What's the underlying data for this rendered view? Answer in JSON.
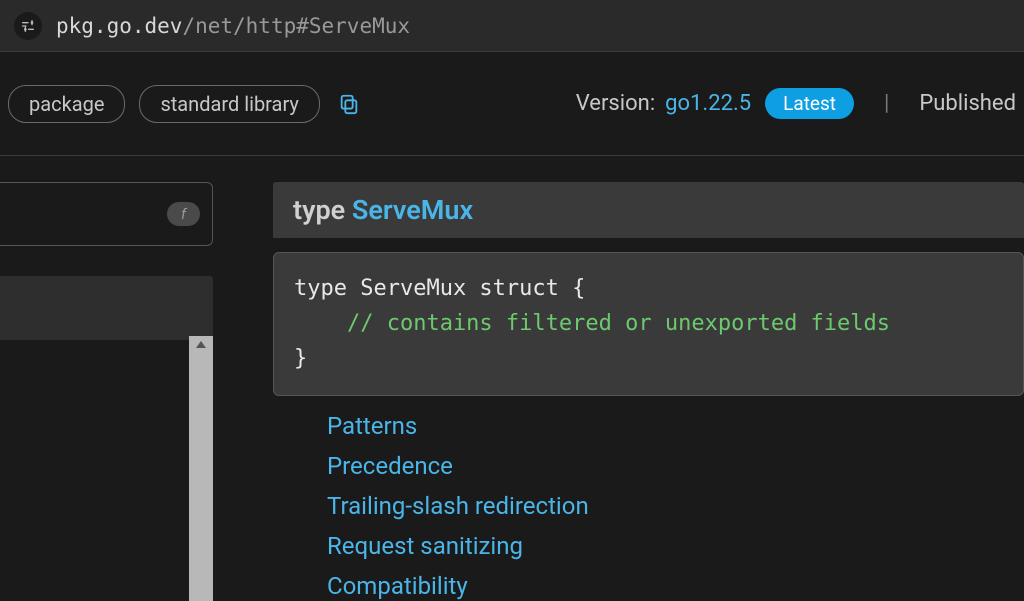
{
  "address": {
    "host": "pkg.go.dev",
    "path": "/net/http#ServeMux"
  },
  "header": {
    "badge_package": "package",
    "badge_stdlib": "standard library",
    "version_label": "Version:",
    "version_value": "go1.22.5",
    "latest_label": "Latest",
    "published_label": "Published"
  },
  "sidebar": {
    "toggle_letter": "f"
  },
  "typedecl": {
    "keyword": "type",
    "name": "ServeMux",
    "code_line1": "type ServeMux struct {",
    "code_comment": "    // contains filtered or unexported fields",
    "code_line3": "}"
  },
  "links": [
    "Patterns",
    "Precedence",
    "Trailing-slash redirection",
    "Request sanitizing",
    "Compatibility"
  ]
}
